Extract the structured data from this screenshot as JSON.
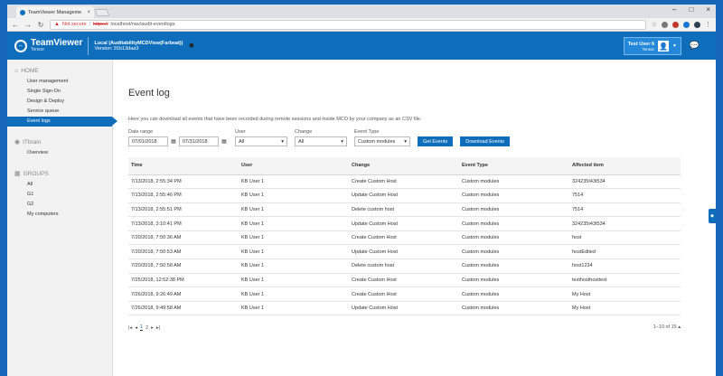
{
  "browser": {
    "tab_title": "TeamViewer Manageme",
    "url_warning": "Not secure",
    "url_scheme": "https://",
    "url_rest": "localhost/nav/audit-eventlogs"
  },
  "header": {
    "brand": "TeamViewer",
    "brand_sub": "Tensor",
    "instance": "Local (AuditabilityMCDView(Farbeat))",
    "version": "Version: 91b13daa3",
    "user_name": "Test User 6",
    "user_org": "Tensor"
  },
  "sidebar": {
    "home_label": "HOME",
    "home_items": [
      "User management",
      "Single Sign-On",
      "Design & Deploy",
      "Service queue",
      "Event logs"
    ],
    "itbrain_label": "ITbrain",
    "itbrain_items": [
      "Overview"
    ],
    "groups_label": "GROUPS",
    "group_items": [
      "All",
      "G1",
      "G2",
      "My computers"
    ]
  },
  "main": {
    "title": "Event log",
    "description": "Here you can download all events that have been recorded during remote sessions and inside MCO by your company as an CSV file.",
    "filters": {
      "date_label": "Date range",
      "date_from": "07/01/2018",
      "date_to": "07/31/2018",
      "user_label": "User",
      "user_value": "All",
      "change_label": "Change",
      "change_value": "All",
      "event_type_label": "Event Type",
      "event_type_value": "Custom modules",
      "get_button": "Get Events",
      "download_button": "Download Events"
    },
    "columns": [
      "Time",
      "User",
      "Change",
      "Event Type",
      "Affected item"
    ],
    "rows": [
      [
        "7/13/2018, 2:55:34 PM",
        "KB User 1",
        "Create Custom Host",
        "Custom modules",
        "324235t43t534"
      ],
      [
        "7/13/2018, 2:55:46 PM",
        "KB User 1",
        "Update Custom Host",
        "Custom modules",
        "7514"
      ],
      [
        "7/13/2018, 2:55:51 PM",
        "KB User 1",
        "Delete custom host",
        "Custom modules",
        "7514"
      ],
      [
        "7/13/2018, 3:10:41 PM",
        "KB User 1",
        "Update Custom Host",
        "Custom modules",
        "324235t43t534"
      ],
      [
        "7/20/2018, 7:50:36 AM",
        "KB User 1",
        "Create Custom Host",
        "Custom modules",
        "host"
      ],
      [
        "7/20/2018, 7:50:53 AM",
        "KB User 1",
        "Update Custom Host",
        "Custom modules",
        "hostEdited"
      ],
      [
        "7/20/2018, 7:50:58 AM",
        "KB User 1",
        "Delete custom host",
        "Custom modules",
        "host1234"
      ],
      [
        "7/25/2018, 12:52:38 PM",
        "KB User 1",
        "Create Custom Host",
        "Custom modules",
        "testhosthosttest"
      ],
      [
        "7/26/2018, 9:26:49 AM",
        "KB User 1",
        "Create Custom Host",
        "Custom modules",
        "My Host"
      ],
      [
        "7/26/2018, 9:49:58 AM",
        "KB User 1",
        "Update Custom Host",
        "Custom modules",
        "My Host"
      ]
    ],
    "pager": {
      "page1": "1",
      "page2": "2",
      "summary": "1–10 of 15 ▴"
    }
  }
}
